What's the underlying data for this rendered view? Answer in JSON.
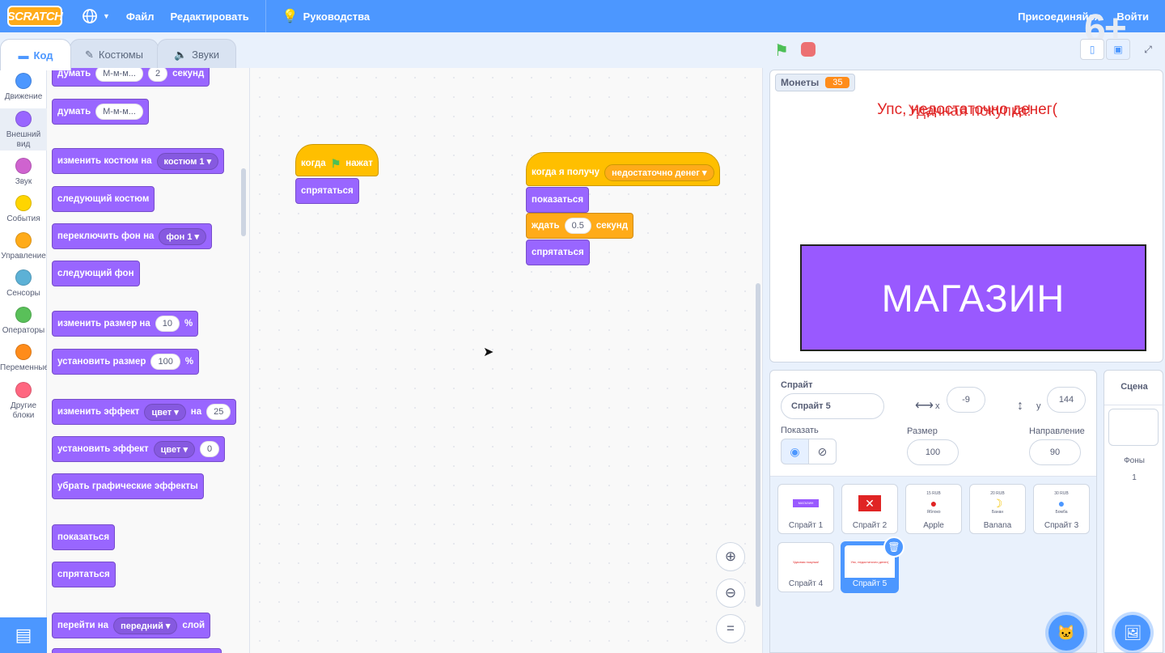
{
  "menu": {
    "logo": "SCRATCH",
    "language_icon": "globe-icon",
    "file": "Файл",
    "edit": "Редактировать",
    "tutorials": "Руководства",
    "join": "Присоединяйся",
    "signin": "Войти"
  },
  "watermark": "6+",
  "tabs": [
    {
      "label": "Код",
      "icon": "code-icon",
      "active": true
    },
    {
      "label": "Костюмы",
      "icon": "brush-icon",
      "active": false
    },
    {
      "label": "Звуки",
      "icon": "speaker-icon",
      "active": false
    }
  ],
  "categories": [
    {
      "label": "Движение",
      "color": "#4c97ff"
    },
    {
      "label": "Внешний вид",
      "color": "#9966ff"
    },
    {
      "label": "Звук",
      "color": "#cf63cf"
    },
    {
      "label": "События",
      "color": "#ffd500"
    },
    {
      "label": "Управление",
      "color": "#ffab19"
    },
    {
      "label": "Сенсоры",
      "color": "#5cb1d6"
    },
    {
      "label": "Операторы",
      "color": "#59c059"
    },
    {
      "label": "Переменные",
      "color": "#ff8c1a"
    },
    {
      "label": "Другие блоки",
      "color": "#ff6680"
    }
  ],
  "palette": {
    "think_secs": {
      "text": "думать",
      "value": "М-м-м...",
      "secs": "2",
      "unit": "секунд"
    },
    "think": {
      "text": "думать",
      "value": "М-м-м..."
    },
    "switch_costume": {
      "text": "изменить костюм на",
      "value": "костюм 1"
    },
    "next_costume": "следующий костюм",
    "switch_backdrop": {
      "text": "переключить фон на",
      "value": "фон 1"
    },
    "next_backdrop": "следующий фон",
    "change_size": {
      "text": "изменить размер на",
      "value": "10",
      "unit": "%"
    },
    "set_size": {
      "text": "установить размер",
      "value": "100",
      "unit": "%"
    },
    "change_effect": {
      "text": "изменить эффект",
      "effect": "цвет",
      "by": "на",
      "value": "25"
    },
    "set_effect": {
      "text": "установить эффект",
      "effect": "цвет",
      "value": "0"
    },
    "clear_effects": "убрать графические эффекты",
    "show": "показаться",
    "hide": "спрятаться",
    "go_to_layer": {
      "text": "перейти на",
      "value": "передний",
      "unit": "слой"
    }
  },
  "scripts": {
    "flag_hat": {
      "when": "когда",
      "clicked": "нажат"
    },
    "hide": "спрятаться",
    "receive_hat": {
      "text": "когда я получу",
      "message": "недостаточно денег"
    },
    "show": "показаться",
    "wait": {
      "text": "ждать",
      "value": "0.5",
      "unit": "секунд"
    },
    "hide2": "спрятаться"
  },
  "stage": {
    "monitor_label": "Монеты",
    "monitor_value": "35",
    "msg1": "Упс, недостаточно денег(",
    "msg2": "Удачная покупка!",
    "shop_label": "МАГАЗИН"
  },
  "sprite_info": {
    "sprite_label": "Спрайт",
    "sprite_name": "Спрайт 5",
    "x_label": "x",
    "x": "-9",
    "y_label": "y",
    "y": "144",
    "show_label": "Показать",
    "size_label": "Размер",
    "size": "100",
    "direction_label": "Направление",
    "direction": "90"
  },
  "sprites": [
    {
      "name": "Спрайт 1",
      "mini": "МАГАЗИН"
    },
    {
      "name": "Спрайт 2",
      "mini": ""
    },
    {
      "name": "Apple",
      "price": "15 RUB",
      "mini": "Яблоко"
    },
    {
      "name": "Banana",
      "price": "20 RUB",
      "mini": "Банан"
    },
    {
      "name": "Спрайт 3",
      "price": "30 RUB",
      "mini": "Бомба"
    },
    {
      "name": "Спрайт 4",
      "mini": "Удачная покупка!"
    },
    {
      "name": "Спрайт 5",
      "mini": "Упс, недостаточно денег(",
      "selected": true
    }
  ],
  "scene": {
    "title": "Сцена",
    "backdrops_label": "Фоны",
    "backdrops_count": "1"
  }
}
